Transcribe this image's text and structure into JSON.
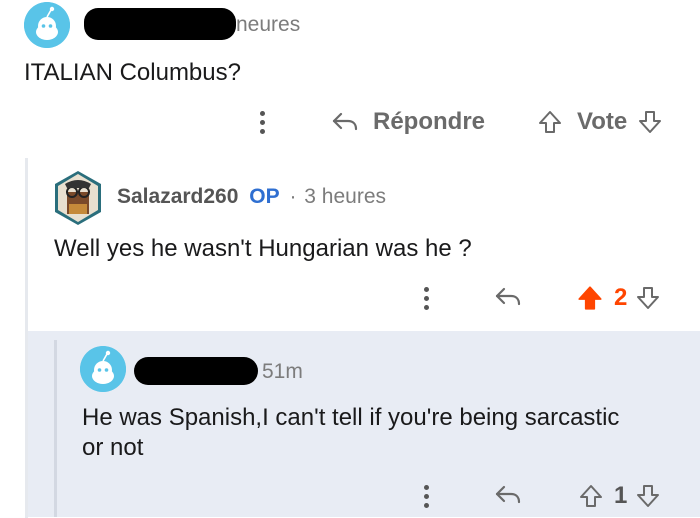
{
  "comment1": {
    "time_fragment": "neures",
    "text": "ITALIAN Columbus?",
    "reply_label": "Répondre",
    "vote_label": "Vote"
  },
  "comment2": {
    "username": "Salazard260",
    "op_badge": "OP",
    "separator": "·",
    "time": "3 heures",
    "text": "Well yes he wasn't Hungarian was he ?",
    "score": "2"
  },
  "comment3": {
    "time": "51m",
    "text_line1": "He was Spanish,I can't tell if you're being sarcastic",
    "text_line2": "or not",
    "score": "1"
  },
  "colors": {
    "upvote_active": "#ff4500",
    "op_blue": "#2f6fd1",
    "highlight_bg": "#e8ecf4",
    "avatar_bg": "#59c4e8"
  }
}
